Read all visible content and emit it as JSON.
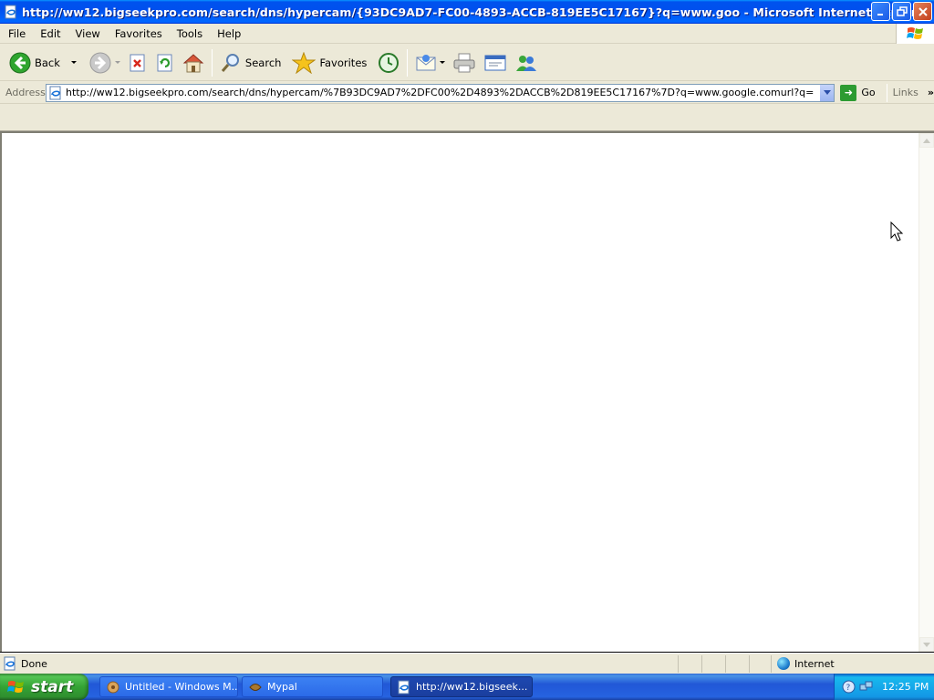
{
  "window": {
    "title": "http://ww12.bigseekpro.com/search/dns/hypercam/{93DC9AD7-FC00-4893-ACCB-819EE5C17167}?q=www.goo - Microsoft Internet Explorer"
  },
  "menubar": {
    "items": [
      "File",
      "Edit",
      "View",
      "Favorites",
      "Tools",
      "Help"
    ]
  },
  "toolbar": {
    "back_label": "Back",
    "search_label": "Search",
    "favorites_label": "Favorites"
  },
  "addressbar": {
    "label": "Address",
    "url": "http://ww12.bigseekpro.com/search/dns/hypercam/%7B93DC9AD7%2DFC00%2D4893%2DACCB%2D819EE5C17167%7D?q=www.google.comurl?q=https:www.bitview.n",
    "go_label": "Go",
    "links_label": "Links"
  },
  "statusbar": {
    "status": "Done",
    "zone": "Internet"
  },
  "taskbar": {
    "start_label": "start",
    "tasks": [
      {
        "label": "Untitled - Windows M..."
      },
      {
        "label": "Mypal"
      },
      {
        "label": "http://ww12.bigseek..."
      }
    ],
    "clock": "12:25 PM"
  },
  "colors": {
    "titlebar_blue": "#0053ee",
    "chrome_bg": "#ece9d8",
    "start_green": "#34a334",
    "taskbar_blue": "#2157d7"
  }
}
